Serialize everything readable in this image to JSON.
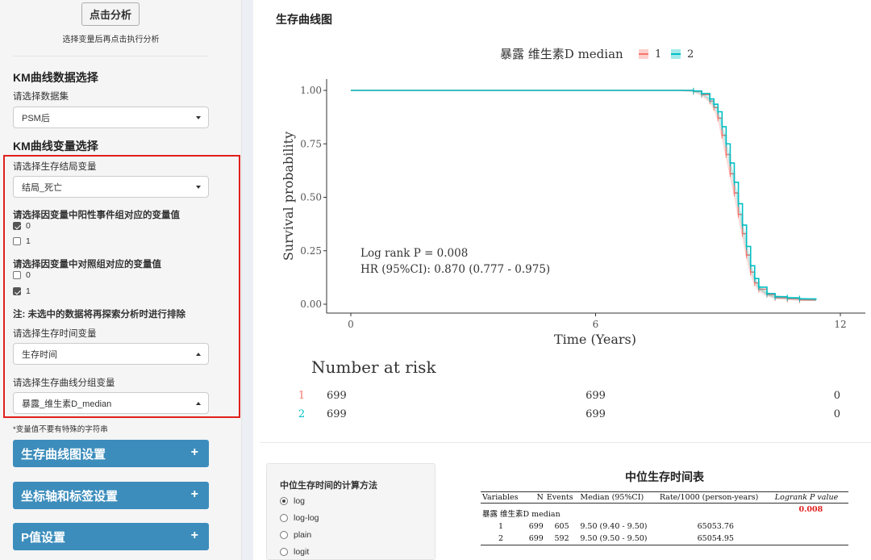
{
  "sidebar": {
    "analyze_button": "点击分析",
    "analyze_hint": "选择变量后再点击执行分析",
    "km_data_heading": "KM曲线数据选择",
    "dataset_label": "请选择数据集",
    "dataset_value": "PSM后",
    "km_var_heading": "KM曲线变量选择",
    "outcome_label": "请选择生存结局变量",
    "outcome_value": "结局_死亡",
    "positive_label": "请选择因变量中阳性事件组对应的变量值",
    "positive_options": [
      {
        "label": "0",
        "checked": true
      },
      {
        "label": "1",
        "checked": false
      }
    ],
    "control_label": "请选择因变量中对照组对应的变量值",
    "control_options": [
      {
        "label": "0",
        "checked": false
      },
      {
        "label": "1",
        "checked": true
      }
    ],
    "exclude_note": "注: 未选中的数据将再探索分析时进行排除",
    "time_label": "请选择生存时间变量",
    "time_value": "生存时间",
    "group_label": "请选择生存曲线分组变量",
    "group_value": "暴露_维生素D_median",
    "var_note": "*变量值不要有特殊的字符串",
    "section_buttons": [
      "生存曲线图设置",
      "坐标轴和标签设置",
      "P值设置"
    ],
    "plus_glyph": "+"
  },
  "main": {
    "title": "生存曲线图",
    "legend_title": "暴露 维生素D median",
    "legend_items": [
      "1",
      "2"
    ],
    "logrank_text": "Log rank P = 0.008",
    "hr_text": "HR (95%CI): 0.870 (0.777 - 0.975)",
    "risk_title": "Number at risk",
    "risk_rows": [
      {
        "label": "1",
        "values": [
          "699",
          "699",
          "0"
        ]
      },
      {
        "label": "2",
        "values": [
          "699",
          "699",
          "0"
        ]
      }
    ],
    "colors": {
      "group1": "#f8766d",
      "group2": "#00bfc4",
      "highlight": "#e0201c",
      "button": "#3c8dbc"
    }
  },
  "chart_data": {
    "type": "line",
    "title": "",
    "xlabel": "Time (Years)",
    "ylabel": "Survival probability",
    "xlim": [
      0,
      12
    ],
    "ylim": [
      0,
      1
    ],
    "x_ticks": [
      "0",
      "6",
      "12"
    ],
    "y_ticks": [
      "0.00",
      "0.25",
      "0.50",
      "0.75",
      "1.00"
    ],
    "legend_position": "top",
    "series": [
      {
        "name": "1",
        "x": [
          0,
          8.0,
          8.4,
          8.6,
          8.8,
          8.9,
          9.0,
          9.1,
          9.2,
          9.3,
          9.4,
          9.5,
          9.6,
          9.7,
          9.8,
          9.9,
          10.0,
          10.2,
          10.4,
          10.7,
          11.0,
          11.4
        ],
        "y": [
          1.0,
          1.0,
          0.995,
          0.98,
          0.95,
          0.92,
          0.87,
          0.79,
          0.7,
          0.61,
          0.52,
          0.42,
          0.33,
          0.23,
          0.15,
          0.1,
          0.07,
          0.045,
          0.03,
          0.025,
          0.02,
          0.02
        ]
      },
      {
        "name": "2",
        "x": [
          0,
          8.0,
          8.4,
          8.6,
          8.8,
          8.9,
          9.0,
          9.1,
          9.2,
          9.3,
          9.4,
          9.5,
          9.6,
          9.7,
          9.8,
          9.9,
          10.0,
          10.2,
          10.4,
          10.7,
          11.0,
          11.4
        ],
        "y": [
          1.0,
          1.0,
          0.997,
          0.985,
          0.96,
          0.935,
          0.9,
          0.83,
          0.75,
          0.66,
          0.57,
          0.47,
          0.37,
          0.27,
          0.18,
          0.12,
          0.08,
          0.05,
          0.035,
          0.03,
          0.025,
          0.02
        ]
      }
    ]
  },
  "median_panel": {
    "title": "中位生存时间的计算方法",
    "options": [
      {
        "label": "log",
        "selected": true
      },
      {
        "label": "log-log",
        "selected": false
      },
      {
        "label": "plain",
        "selected": false
      },
      {
        "label": "logit",
        "selected": false
      }
    ]
  },
  "median_table": {
    "title": "中位生存时间表",
    "headers": [
      "Variables",
      "N",
      "Events",
      "Median (95%CI)",
      "Rate/1000 (person-years)",
      "Logrank P value"
    ],
    "group_row": {
      "label": "暴露 维生素D median",
      "p": "0.008"
    },
    "rows": [
      {
        "label": "1",
        "n": "699",
        "events": "605",
        "median": "9.50 (9.40 - 9.50)",
        "rate": "65053.76"
      },
      {
        "label": "2",
        "n": "699",
        "events": "592",
        "median": "9.50 (9.50 - 9.50)",
        "rate": "65054.95"
      }
    ]
  }
}
